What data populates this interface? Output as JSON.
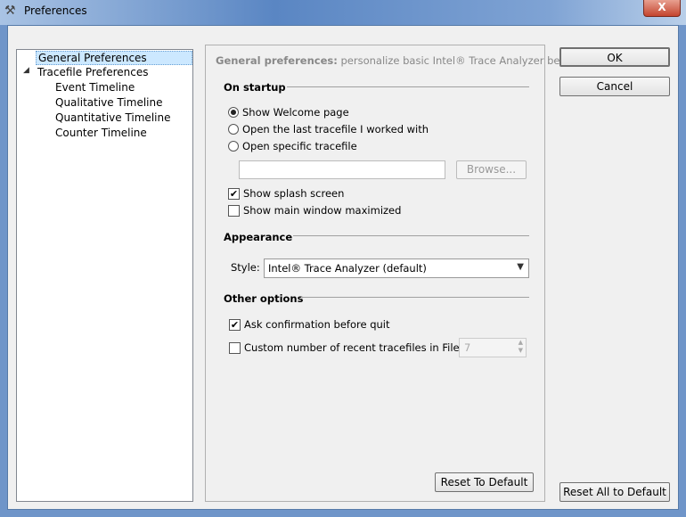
{
  "window": {
    "title": "Preferences",
    "close": "X"
  },
  "tree": {
    "items": [
      {
        "label": "General Preferences"
      },
      {
        "label": "Tracefile Preferences"
      },
      {
        "label": "Event Timeline"
      },
      {
        "label": "Qualitative Timeline"
      },
      {
        "label": "Quantitative Timeline"
      },
      {
        "label": "Counter Timeline"
      }
    ]
  },
  "main": {
    "heading_bold": "General preferences:",
    "heading_rest": "personalize basic Intel® Trace Analyzer behavior",
    "startup": {
      "title": "On startup",
      "options": [
        "Show Welcome page",
        "Open the last tracefile I worked with",
        "Open specific tracefile"
      ],
      "file_value": "",
      "browse": "Browse...",
      "splash": "Show splash screen",
      "maximized": "Show main window maximized"
    },
    "appearance": {
      "title": "Appearance",
      "style_label": "Style:",
      "style_value": "Intel® Trace Analyzer (default)"
    },
    "other": {
      "title": "Other options",
      "confirm": "Ask confirmation before quit",
      "recent": "Custom number of recent tracefiles in File menu:",
      "recent_value": "7"
    },
    "reset": "Reset To Default"
  },
  "buttons": {
    "ok": "OK",
    "cancel": "Cancel",
    "reset_all": "Reset All to Default"
  }
}
